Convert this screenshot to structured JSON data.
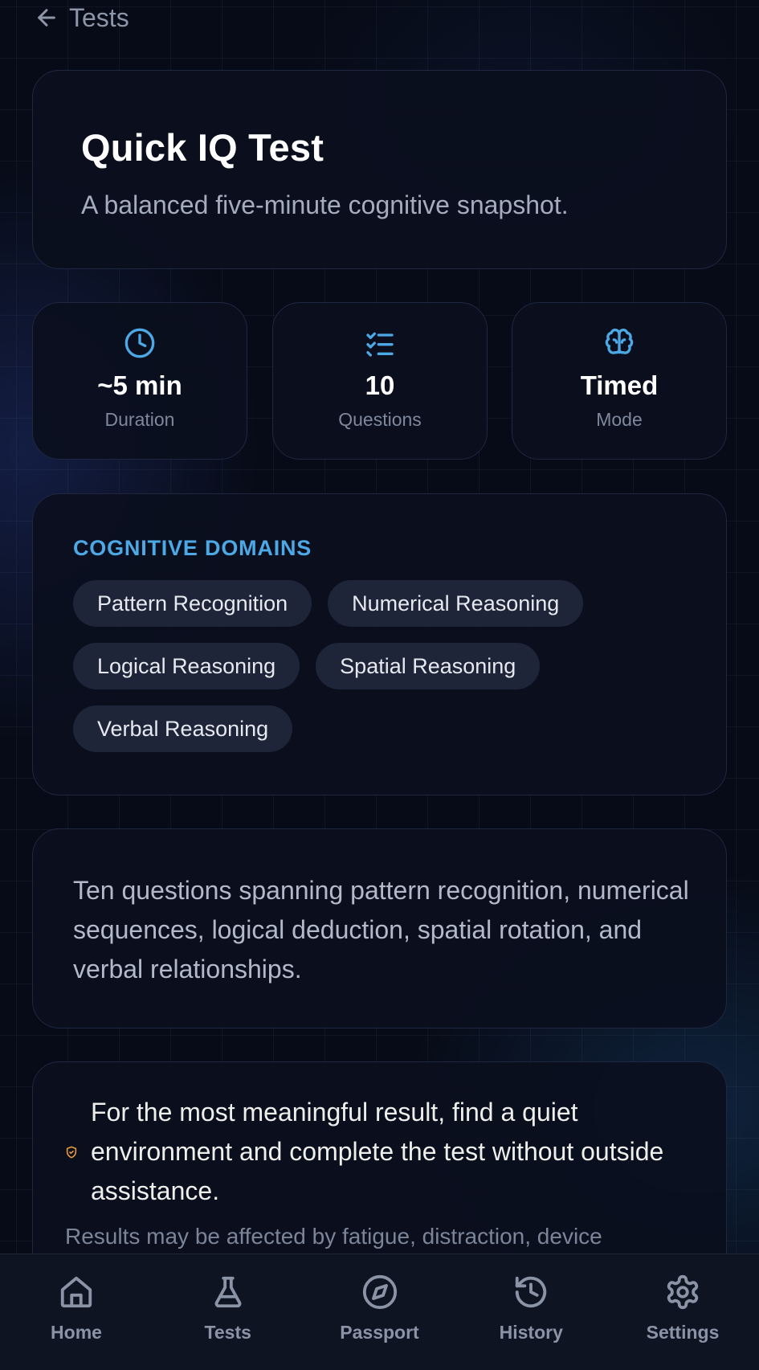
{
  "header": {
    "back_label": "Tests"
  },
  "hero": {
    "title": "Quick IQ Test",
    "subtitle": "A balanced five-minute cognitive snapshot."
  },
  "stats": [
    {
      "icon": "clock-icon",
      "value": "~5 min",
      "label": "Duration"
    },
    {
      "icon": "checklist-icon",
      "value": "10",
      "label": "Questions"
    },
    {
      "icon": "brain-icon",
      "value": "Timed",
      "label": "Mode"
    }
  ],
  "domains": {
    "heading": "COGNITIVE DOMAINS",
    "chips": [
      "Pattern Recognition",
      "Numerical Reasoning",
      "Logical Reasoning",
      "Spatial Reasoning",
      "Verbal Reasoning"
    ]
  },
  "description": "Ten questions spanning pattern recognition, numerical sequences, logical deduction, spatial rotation, and verbal relationships.",
  "note": {
    "icon": "shield-check-icon",
    "text": "For the most meaningful result, find a quiet environment and complete the test without outside assistance.",
    "subtext": "Results may be affected by fatigue, distraction, device"
  },
  "nav": [
    {
      "icon": "home-icon",
      "label": "Home"
    },
    {
      "icon": "flask-icon",
      "label": "Tests"
    },
    {
      "icon": "compass-icon",
      "label": "Passport"
    },
    {
      "icon": "history-icon",
      "label": "History"
    },
    {
      "icon": "gear-icon",
      "label": "Settings"
    }
  ],
  "colors": {
    "background": "#070b17",
    "card": "#0b0f1e",
    "accent": "#4da8e6",
    "chip": "#1e2538",
    "warning": "#e89a3c",
    "nav_icon": "#8b94a6"
  }
}
